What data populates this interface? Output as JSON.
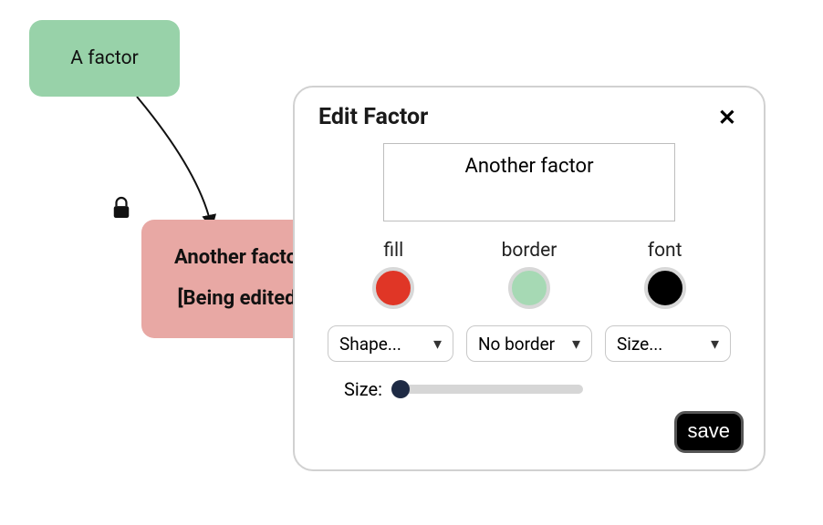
{
  "nodes": {
    "a": {
      "label": "A factor"
    },
    "b": {
      "label_line1": "Another factor",
      "label_line2": "[Being edited]"
    }
  },
  "modal": {
    "title": "Edit Factor",
    "name_value": "Another factor",
    "color_labels": {
      "fill": "fill",
      "border": "border",
      "font": "font"
    },
    "colors": {
      "fill": "#e03626",
      "border": "#a6d9b4",
      "font": "#000000"
    },
    "selects": {
      "shape": "Shape...",
      "border": "No border",
      "size": "Size..."
    },
    "size_label": "Size:",
    "save_label": "save"
  }
}
